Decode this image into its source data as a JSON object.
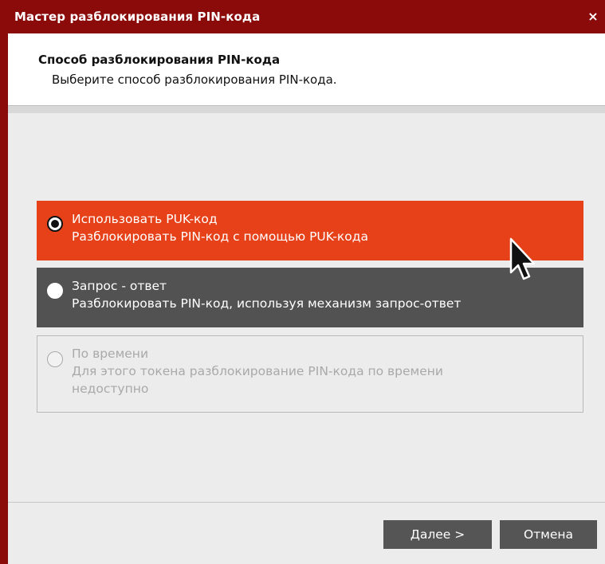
{
  "window": {
    "title": "Мастер разблокирования PIN-кода",
    "close_glyph": "×"
  },
  "header": {
    "title": "Способ разблокирования PIN-кода",
    "subtitle": "Выберите способ разблокирования PIN-кода."
  },
  "options": [
    {
      "title": "Использовать PUK-код",
      "description": "Разблокировать PIN-код с помощью PUK-кода",
      "selected": true,
      "enabled": true
    },
    {
      "title": "Запрос - ответ",
      "description": "Разблокировать PIN-код, используя механизм запрос-ответ",
      "selected": false,
      "enabled": true
    },
    {
      "title": "По времени",
      "description_line1": "Для этого токена разблокирование PIN-кода по времени",
      "description_line2": "недоступно",
      "selected": false,
      "enabled": false
    }
  ],
  "buttons": {
    "next_underlined": "Д",
    "next_rest": "алее >",
    "cancel": "Отмена"
  },
  "colors": {
    "titlebar": "#8b0a0a",
    "selected_option": "#e64118",
    "hover_option": "#525252",
    "button": "#555555"
  },
  "icons": {
    "close": "close-icon",
    "cursor": "mouse-pointer-icon"
  }
}
